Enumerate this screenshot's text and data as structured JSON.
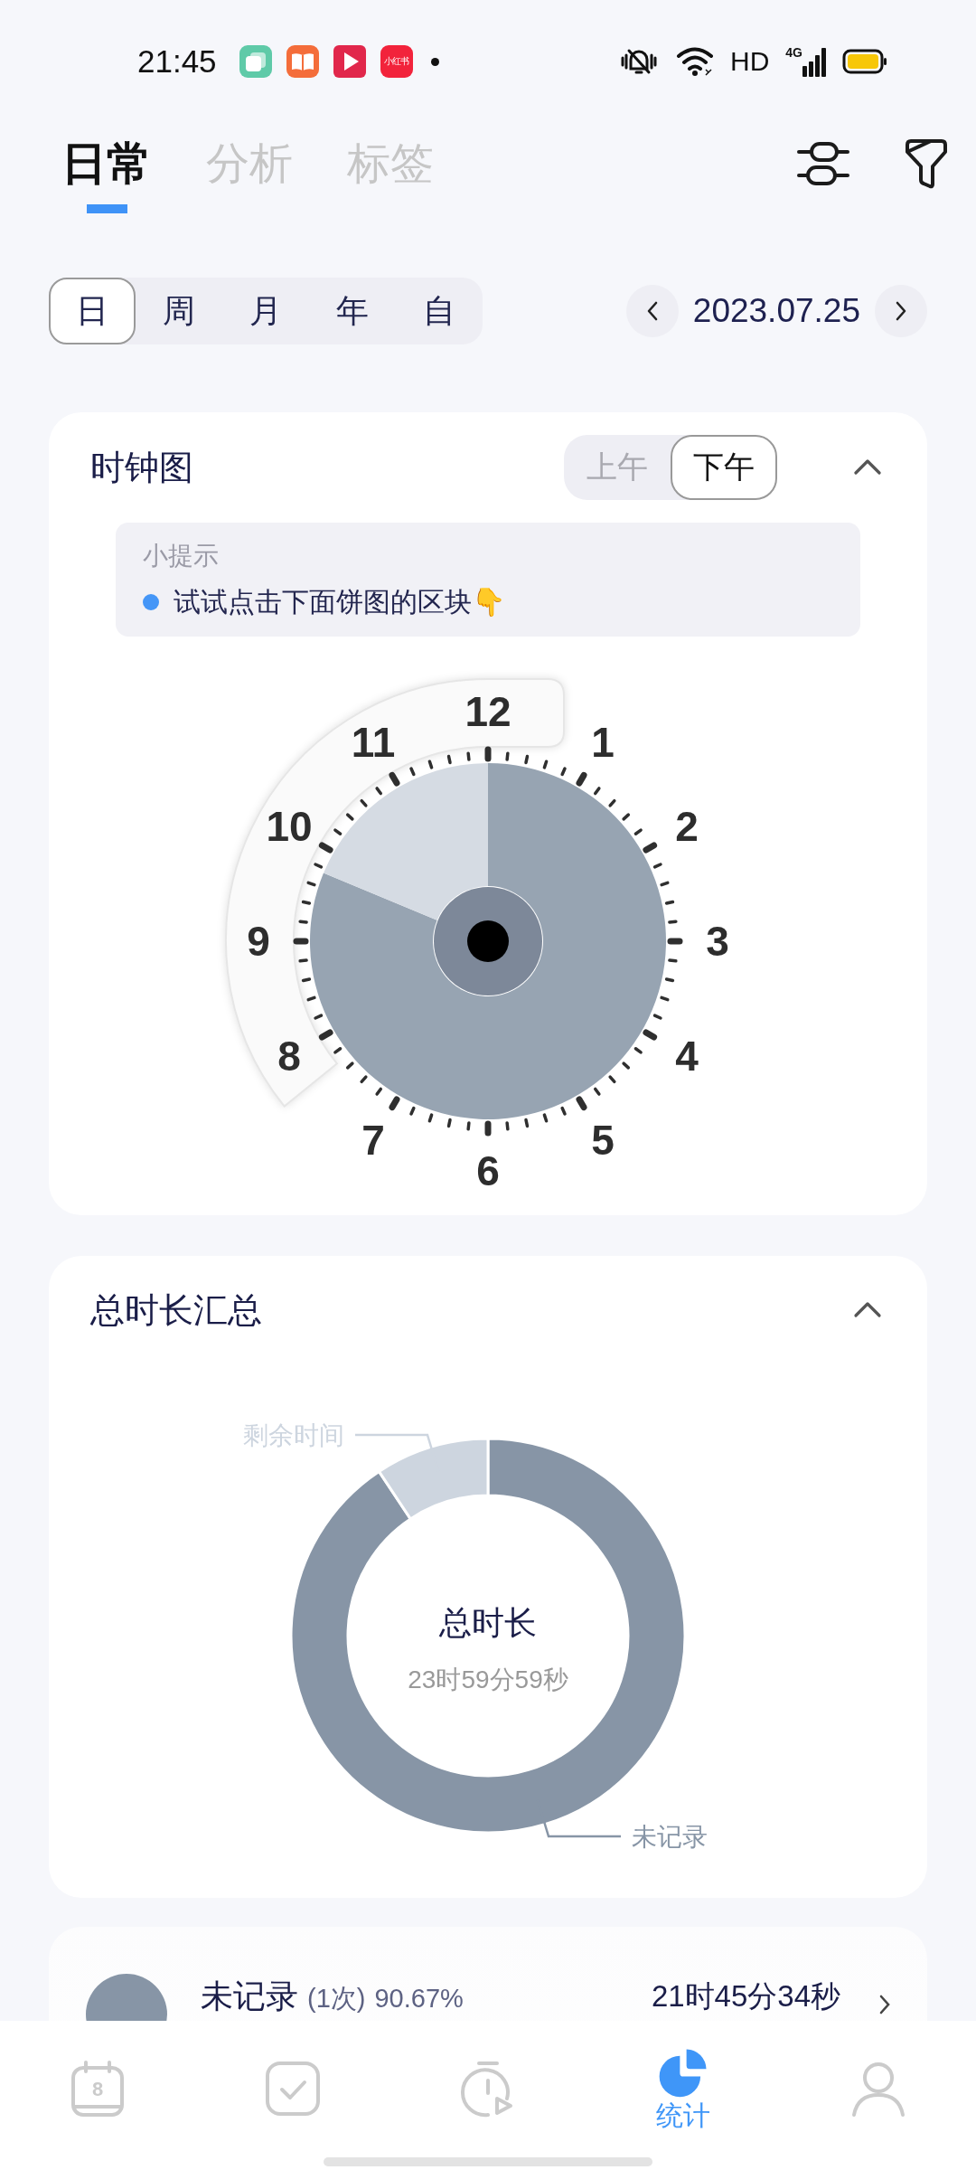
{
  "status_bar": {
    "time": "21:45",
    "apps": [
      {
        "kind": "layers"
      },
      {
        "kind": "book"
      },
      {
        "kind": "play"
      },
      {
        "kind": "text",
        "label": "小红书"
      }
    ],
    "network": "HD",
    "cell_type": "4G"
  },
  "tabs": [
    {
      "label": "日常",
      "selected": true
    },
    {
      "label": "分析",
      "selected": false
    },
    {
      "label": "标签",
      "selected": false
    }
  ],
  "period": [
    {
      "label": "日",
      "selected": true
    },
    {
      "label": "周",
      "selected": false
    },
    {
      "label": "月",
      "selected": false
    },
    {
      "label": "年",
      "selected": false
    },
    {
      "label": "自",
      "selected": false
    }
  ],
  "date": "2023.07.25",
  "clock_card": {
    "title": "时钟图",
    "expanded": true,
    "halves": [
      {
        "label": "上午",
        "selected": false
      },
      {
        "label": "下午",
        "selected": true
      }
    ],
    "tip": {
      "title": "小提示",
      "text": "试试点击下面饼图的区块👇"
    },
    "hours": [
      "12",
      "1",
      "2",
      "3",
      "4",
      "5",
      "6",
      "7",
      "8",
      "9",
      "10",
      "11"
    ],
    "chart_data": {
      "type": "donut",
      "values": [
        81.25,
        18.75
      ]
    }
  },
  "total_card": {
    "title": "总时长汇总",
    "expanded": true,
    "center_title": "总时长",
    "center_value": "23时59分59秒",
    "chart_data": {
      "type": "donut",
      "categories": [
        "未记录",
        "剩余时间"
      ],
      "values": [
        90.67,
        9.33
      ]
    }
  },
  "records": [
    {
      "name": "未记录",
      "count": "(1次)",
      "percent": "90.67%",
      "duration": "21时45分34秒",
      "color": "#8795a6"
    }
  ],
  "nav": [
    {
      "kind": "calendar",
      "badge": "8",
      "selected": false
    },
    {
      "kind": "tasks",
      "selected": false
    },
    {
      "kind": "timer",
      "selected": false
    },
    {
      "kind": "stats",
      "label": "统计",
      "selected": true
    },
    {
      "kind": "profile",
      "selected": false
    }
  ]
}
